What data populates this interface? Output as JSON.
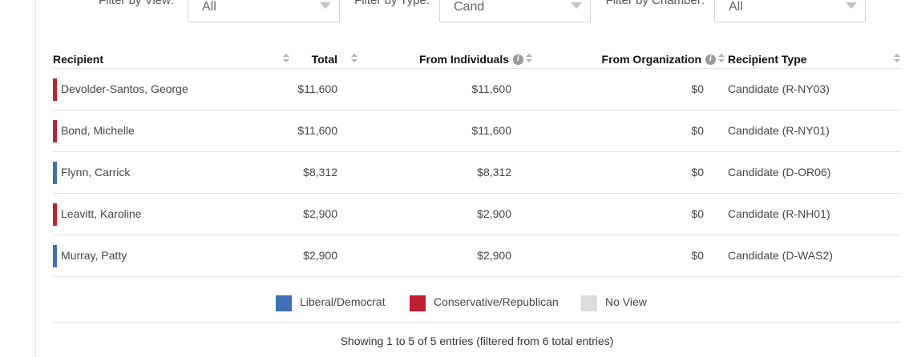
{
  "filters": [
    {
      "label": "Filter by View:",
      "value": "All"
    },
    {
      "label": "Filter by Type:",
      "value": "Cand"
    },
    {
      "label": "Filter by Chamber:",
      "value": "All"
    }
  ],
  "table": {
    "headers": {
      "recipient": "Recipient",
      "total": "Total",
      "from_individuals": "From Individuals",
      "from_organization": "From Organization",
      "recipient_type": "Recipient Type"
    },
    "rows": [
      {
        "name": "Devolder-Santos, George",
        "total": "$11,600",
        "individuals": "$11,600",
        "organization": "$0",
        "type": "Candidate (R-NY03)",
        "party_color": "#c0202e"
      },
      {
        "name": "Bond, Michelle",
        "total": "$11,600",
        "individuals": "$11,600",
        "organization": "$0",
        "type": "Candidate (R-NY01)",
        "party_color": "#c0202e"
      },
      {
        "name": "Flynn, Carrick",
        "total": "$8,312",
        "individuals": "$8,312",
        "organization": "$0",
        "type": "Candidate (D-OR06)",
        "party_color": "#3c70b8"
      },
      {
        "name": "Leavitt, Karoline",
        "total": "$2,900",
        "individuals": "$2,900",
        "organization": "$0",
        "type": "Candidate (R-NH01)",
        "party_color": "#c0202e"
      },
      {
        "name": "Murray, Patty",
        "total": "$2,900",
        "individuals": "$2,900",
        "organization": "$0",
        "type": "Candidate (D-WAS2)",
        "party_color": "#3c70b8"
      }
    ]
  },
  "legend": [
    {
      "label": "Liberal/Democrat",
      "color": "#3c70b8"
    },
    {
      "label": "Conservative/Republican",
      "color": "#c0202e"
    },
    {
      "label": "No View",
      "color": "#dddddd"
    }
  ],
  "table_info": "Showing 1 to 5 of 5 entries (filtered from 6 total entries)"
}
